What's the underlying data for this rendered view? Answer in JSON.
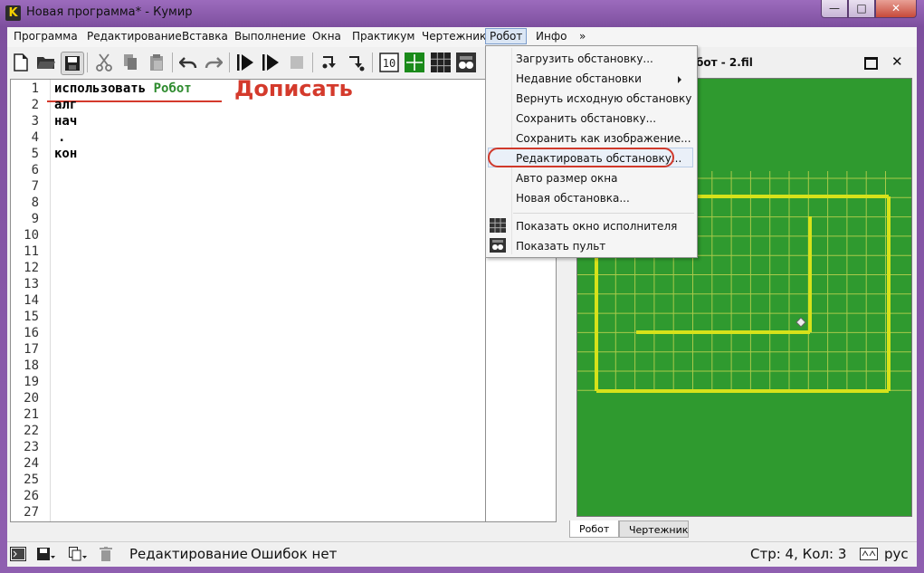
{
  "window": {
    "app_icon_letter": "K",
    "title": "Новая программа* - Кумир",
    "minimize": "—",
    "maximize": "□",
    "close": "✕"
  },
  "menubar": {
    "items": [
      "Программа",
      "Редактирование",
      "Вставка",
      "Выполнение",
      "Окна",
      "Практикум",
      "Чертежник",
      "Робот",
      "Инфо",
      "»"
    ],
    "active": "Робот"
  },
  "toolbar": {
    "icons": [
      "new-file-icon",
      "open-folder-icon",
      "save-icon",
      "cut-icon",
      "copy-icon",
      "paste-icon",
      "undo-icon",
      "redo-icon",
      "run-icon",
      "run-step-icon",
      "stop-icon",
      "step-into-icon",
      "step-out-icon",
      "counter-10-icon",
      "draw-grid-icon",
      "robot-grid-icon",
      "robot-remote-icon"
    ]
  },
  "editor": {
    "line_numbers": [
      "1",
      "2",
      "3",
      "4",
      "5",
      "6",
      "7",
      "8",
      "9",
      "10",
      "11",
      "12",
      "13",
      "14",
      "15",
      "16",
      "17",
      "18",
      "19",
      "20",
      "21",
      "22",
      "23",
      "24",
      "25",
      "26",
      "27"
    ],
    "line1_keyword": "использовать",
    "line1_name": "Робот",
    "line2": "алг",
    "line3": "нач",
    "line4": ".",
    "line5": "кон",
    "annotation": "Дописать"
  },
  "robot_panel": {
    "title": "бот - 2.fil",
    "field_color": "#2f9a2f",
    "wall_color": "#d6e21a",
    "tabs": [
      "Робот",
      "Чертежник"
    ]
  },
  "robot_menu": {
    "items": [
      "Загрузить обстановку...",
      "Недавние обстановки",
      "Вернуть исходную обстановку",
      "Сохранить обстановку...",
      "Сохранить как изображение...",
      "Редактировать обстановку...",
      "Авто размер окна",
      "Новая обстановка...",
      "Показать окно исполнителя",
      "Показать пульт"
    ],
    "highlighted": "Редактировать обстановку..."
  },
  "statusbar": {
    "mode": "Редактирование",
    "errors": "Ошибок нет",
    "position": "Стр: 4, Кол: 3",
    "language": "рус"
  }
}
